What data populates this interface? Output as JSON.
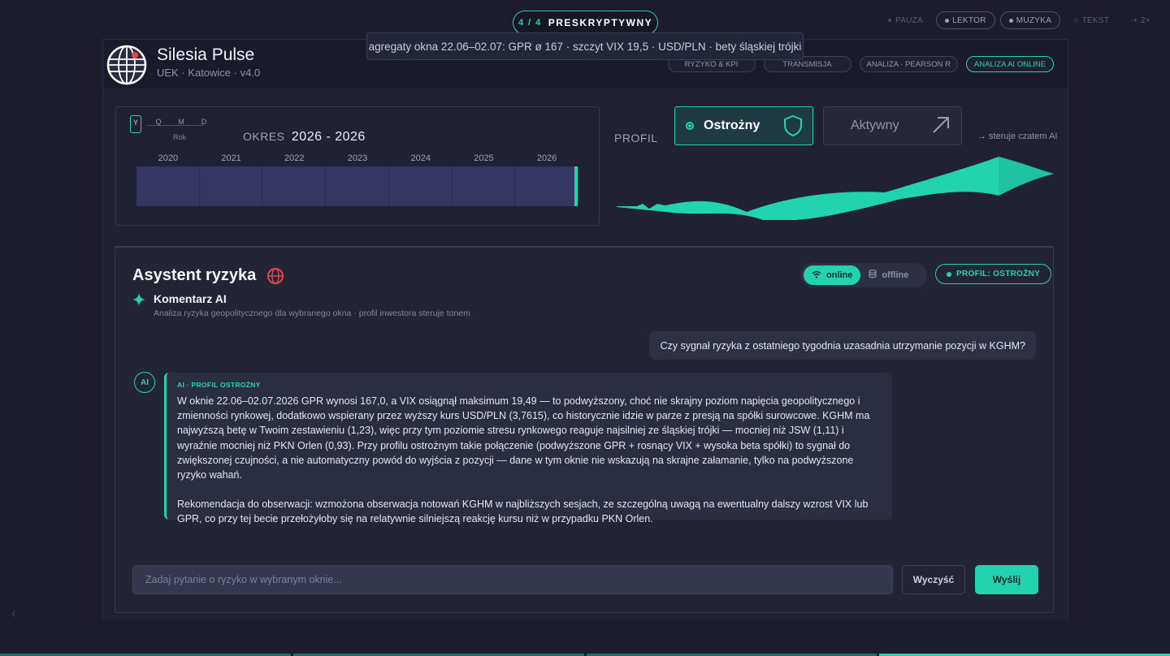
{
  "overlay": {
    "step_counter": "4 / 4",
    "step_label": "PRESKRYPTYWNY",
    "controls": [
      {
        "label": "PAUZA",
        "icon": "pause-icon",
        "active": false
      },
      {
        "label": "LEKTOR",
        "icon": "dot-icon",
        "active": true
      },
      {
        "label": "MUZYKA",
        "icon": "dot-icon",
        "active": true
      },
      {
        "label": "TEKST",
        "icon": "circle-icon",
        "active": false
      },
      {
        "label": "2×",
        "icon": "speed-icon",
        "active": false
      }
    ],
    "tooltip": "agregaty okna 22.06–02.07: GPR ø 167 · szczyt VIX 19,5 · USD/PLN · bety śląskiej trójki"
  },
  "header": {
    "title": "Silesia Pulse",
    "subtitle": "UEK · Katowice · v4.0",
    "nav": [
      "RYZYKO & KPI",
      "TRANSMISJA",
      "ANALIZA · PEARSON R",
      "ANALIZA AI ONLINE"
    ],
    "nav_active_index": 3
  },
  "period": {
    "granularity": [
      "Y",
      "Q",
      "M",
      "D"
    ],
    "granularity_selected": "Rok",
    "okres_label": "OKRES",
    "okres_value": "2026 - 2026",
    "years": [
      "2020",
      "2021",
      "2022",
      "2023",
      "2024",
      "2025",
      "2026"
    ]
  },
  "profile": {
    "label": "PROFIL",
    "options": [
      {
        "name": "Ostrożny",
        "icon": "shield-icon",
        "selected": true
      },
      {
        "name": "Aktywny",
        "icon": "arrow-up-right-icon",
        "selected": false
      }
    ],
    "hint": "→ steruje czatem AI"
  },
  "chat": {
    "title": "Asystent ryzyka",
    "mode": {
      "online": "online",
      "offline": "offline",
      "selected": "online"
    },
    "profile_badge": "PROFIL: OSTROŻNY",
    "section_title": "Komentarz AI",
    "section_subtitle": "Analiza ryzyka geopolitycznego dla wybranego okna · profil inwestora steruje tonem",
    "user_message": "Czy sygnał ryzyka z ostatniego tygodnia uzasadnia utrzymanie pozycji w KGHM?",
    "ai_avatar": "AI",
    "ai_tag": "AI · PROFIL OSTROŻNY",
    "ai_paragraph_1": "W oknie 22.06–02.07.2026 GPR wynosi 167,0, a VIX osiągnął maksimum 19,49 — to podwyższony, choć nie skrajny poziom napięcia geopolitycznego i zmienności rynkowej, dodatkowo wspierany przez wyższy kurs USD/PLN (3,7615), co historycznie idzie w parze z presją na spółki surowcowe. KGHM ma najwyższą betę w Twoim zestawieniu (1,23), więc przy tym poziomie stresu rynkowego reaguje najsilniej ze śląskiej trójki — mocniej niż JSW (1,11) i wyraźnie mocniej niż PKN Orlen (0,93). Przy profilu ostrożnym takie połączenie (podwyższone GPR + rosnący VIX + wysoka beta spółki) to sygnał do zwiększonej czujności, a nie automatyczny powód do wyjścia z pozycji — dane w tym oknie nie wskazują na skrajne załamanie, tylko na podwyższone ryzyko wahań.",
    "ai_paragraph_2": "Rekomendacja do obserwacji: wzmożona obserwacja notowań KGHM w najbliższych sesjach, ze szczególną uwagą na ewentualny dalszy wzrost VIX lub GPR, co przy tej becie przełożyłoby się na relatywnie silniejszą reakcję kursu niż w przypadku PKN Orlen.",
    "input_placeholder": "Zadaj pytanie o ryzyko w wybranym oknie...",
    "clear_label": "Wyczyść",
    "send_label": "Wyślij"
  },
  "colors": {
    "accent": "#22d3b0",
    "background": "#1c1c2c",
    "panel": "#202232",
    "timeline": "#353661"
  }
}
